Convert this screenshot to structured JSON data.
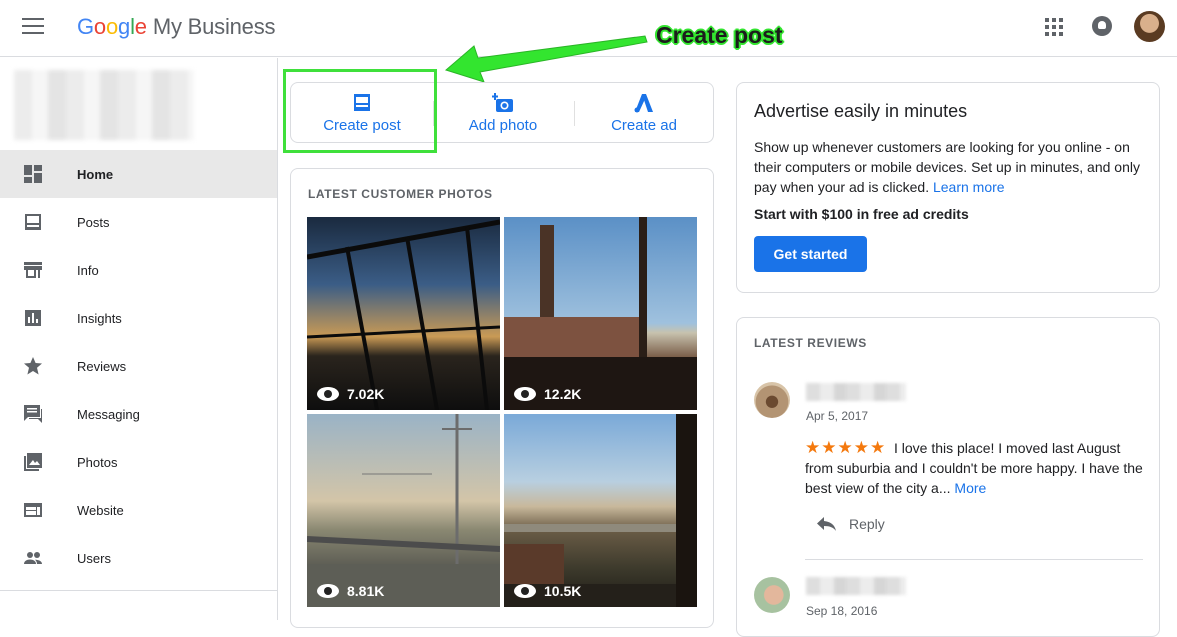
{
  "header": {
    "logo_letters": [
      "G",
      "o",
      "o",
      "g",
      "l",
      "e"
    ],
    "product": "My Business",
    "icons": [
      "hamburger-menu-icon",
      "apps-grid-icon",
      "notifications-icon",
      "account-avatar"
    ]
  },
  "annotation": {
    "callout_text": "Create post",
    "accent_color": "#33e52f"
  },
  "sidebar": {
    "items": [
      {
        "label": "Home",
        "icon": "dashboard-icon",
        "active": true
      },
      {
        "label": "Posts",
        "icon": "posts-icon"
      },
      {
        "label": "Info",
        "icon": "storefront-icon"
      },
      {
        "label": "Insights",
        "icon": "bar-chart-icon"
      },
      {
        "label": "Reviews",
        "icon": "star-icon"
      },
      {
        "label": "Messaging",
        "icon": "chat-icon"
      },
      {
        "label": "Photos",
        "icon": "image-icon"
      },
      {
        "label": "Website",
        "icon": "web-icon"
      },
      {
        "label": "Users",
        "icon": "people-icon"
      }
    ]
  },
  "actions": {
    "create_post": "Create post",
    "add_photo": "Add photo",
    "create_ad": "Create ad"
  },
  "photos": {
    "heading": "LATEST CUSTOMER PHOTOS",
    "items": [
      {
        "views": "7.02K"
      },
      {
        "views": "12.2K"
      },
      {
        "views": "8.81K"
      },
      {
        "views": "10.5K"
      }
    ]
  },
  "ad": {
    "title": "Advertise easily in minutes",
    "body": "Show up whenever customers are looking for you online - on their computers or mobile devices. Set up in minutes, and only pay when your ad is clicked.",
    "learn_more": "Learn more",
    "credit": "Start with $100 in free ad credits",
    "cta": "Get started",
    "accent_color": "#1a73e8"
  },
  "reviews": {
    "heading": "LATEST REVIEWS",
    "items": [
      {
        "date": "Apr 5, 2017",
        "stars": "★★★★★",
        "rating": 5,
        "text": "I love this place! I moved last August from suburbia and I couldn't be more happy. I have the best view of the city a...",
        "more": "More",
        "reply": "Reply"
      },
      {
        "date": "Sep 18, 2016"
      }
    ],
    "star_color": "#f4790e"
  }
}
